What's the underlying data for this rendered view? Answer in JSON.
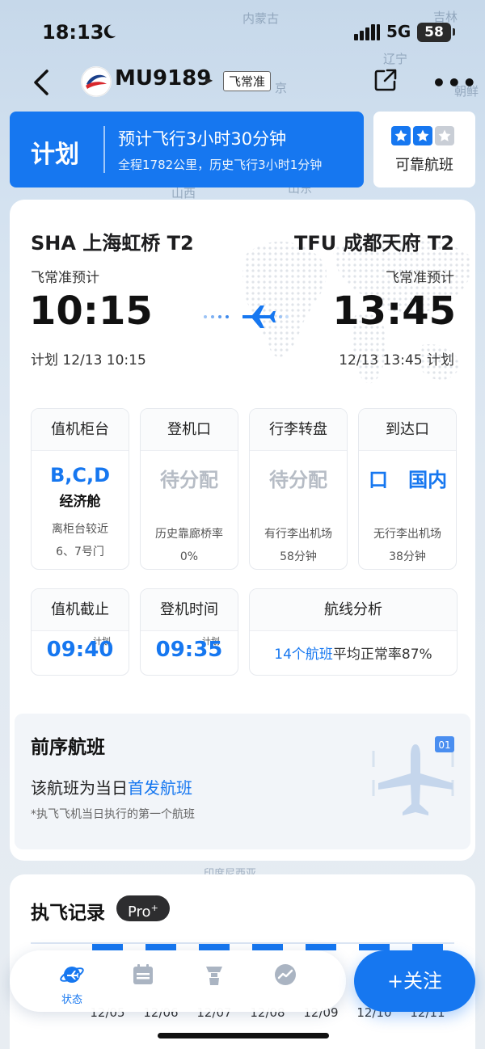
{
  "status_bar": {
    "time": "18:13",
    "network": "5G",
    "battery": "58"
  },
  "map_labels": [
    "内蒙古",
    "吉林",
    "辽宁",
    "朝鲜",
    "京",
    "山西",
    "山东",
    "印度尼西亚"
  ],
  "nav": {
    "flight_no": "MU9189",
    "tag": "飞常准"
  },
  "plan": {
    "label": "计划",
    "main": "预计飞行3小时30分钟",
    "sub": "全程1782公里，历史飞行3小时1分钟"
  },
  "reliability": {
    "stars": 2,
    "total_stars": 3,
    "label": "可靠航班"
  },
  "route": {
    "origin": "SHA 上海虹桥 T2",
    "destination": "TFU 成都天府 T2",
    "origin_est_label": "飞常准预计",
    "dest_est_label": "飞常准预计",
    "dep_time": "10:15",
    "arr_time": "13:45",
    "dep_plan": "计划 12/13 10:15",
    "arr_plan": "12/13 13:45 计划"
  },
  "info": [
    {
      "title": "值机柜台",
      "main": "B,C,D",
      "sub": "经济舱",
      "note1": "离柜台较近",
      "note2": "6、7号门"
    },
    {
      "title": "登机口",
      "main": "待分配",
      "note1": "历史靠廊桥率",
      "note2": "0%"
    },
    {
      "title": "行李转盘",
      "main": "待分配",
      "note1": "有行李出机场",
      "note2": "58分钟"
    },
    {
      "title": "到达口",
      "main": "口   国内",
      "note1": "无行李出机场",
      "note2": "38分钟"
    }
  ],
  "checkin_cutoff": {
    "title": "值机截止",
    "tag": "计划",
    "time": "09:40"
  },
  "boarding": {
    "title": "登机时间",
    "tag": "计划",
    "time": "09:35"
  },
  "route_analysis": {
    "title": "航线分析",
    "highlight": "14个航班",
    "rest": "平均正常率87%"
  },
  "previous": {
    "title": "前序航班",
    "text": "该航班为当日",
    "highlight": "首发航班",
    "note": "*执飞飞机当日执行的第一个航班",
    "badge": "01"
  },
  "record": {
    "title": "执飞记录",
    "pro": "Pro",
    "dates": [
      "12/05",
      "12/06",
      "12/07",
      "12/08",
      "12/09",
      "12/10",
      "12/11"
    ]
  },
  "tabs": [
    {
      "label": "状态",
      "icon": "status-planet-icon"
    },
    {
      "label": "",
      "icon": "calendar-icon"
    },
    {
      "label": "",
      "icon": "tower-icon"
    },
    {
      "label": "",
      "icon": "chart-icon"
    }
  ],
  "follow_button": "+关注",
  "colors": {
    "accent": "#1677f0",
    "star_filled": "#1677f0",
    "star_empty": "#c9ced6"
  }
}
